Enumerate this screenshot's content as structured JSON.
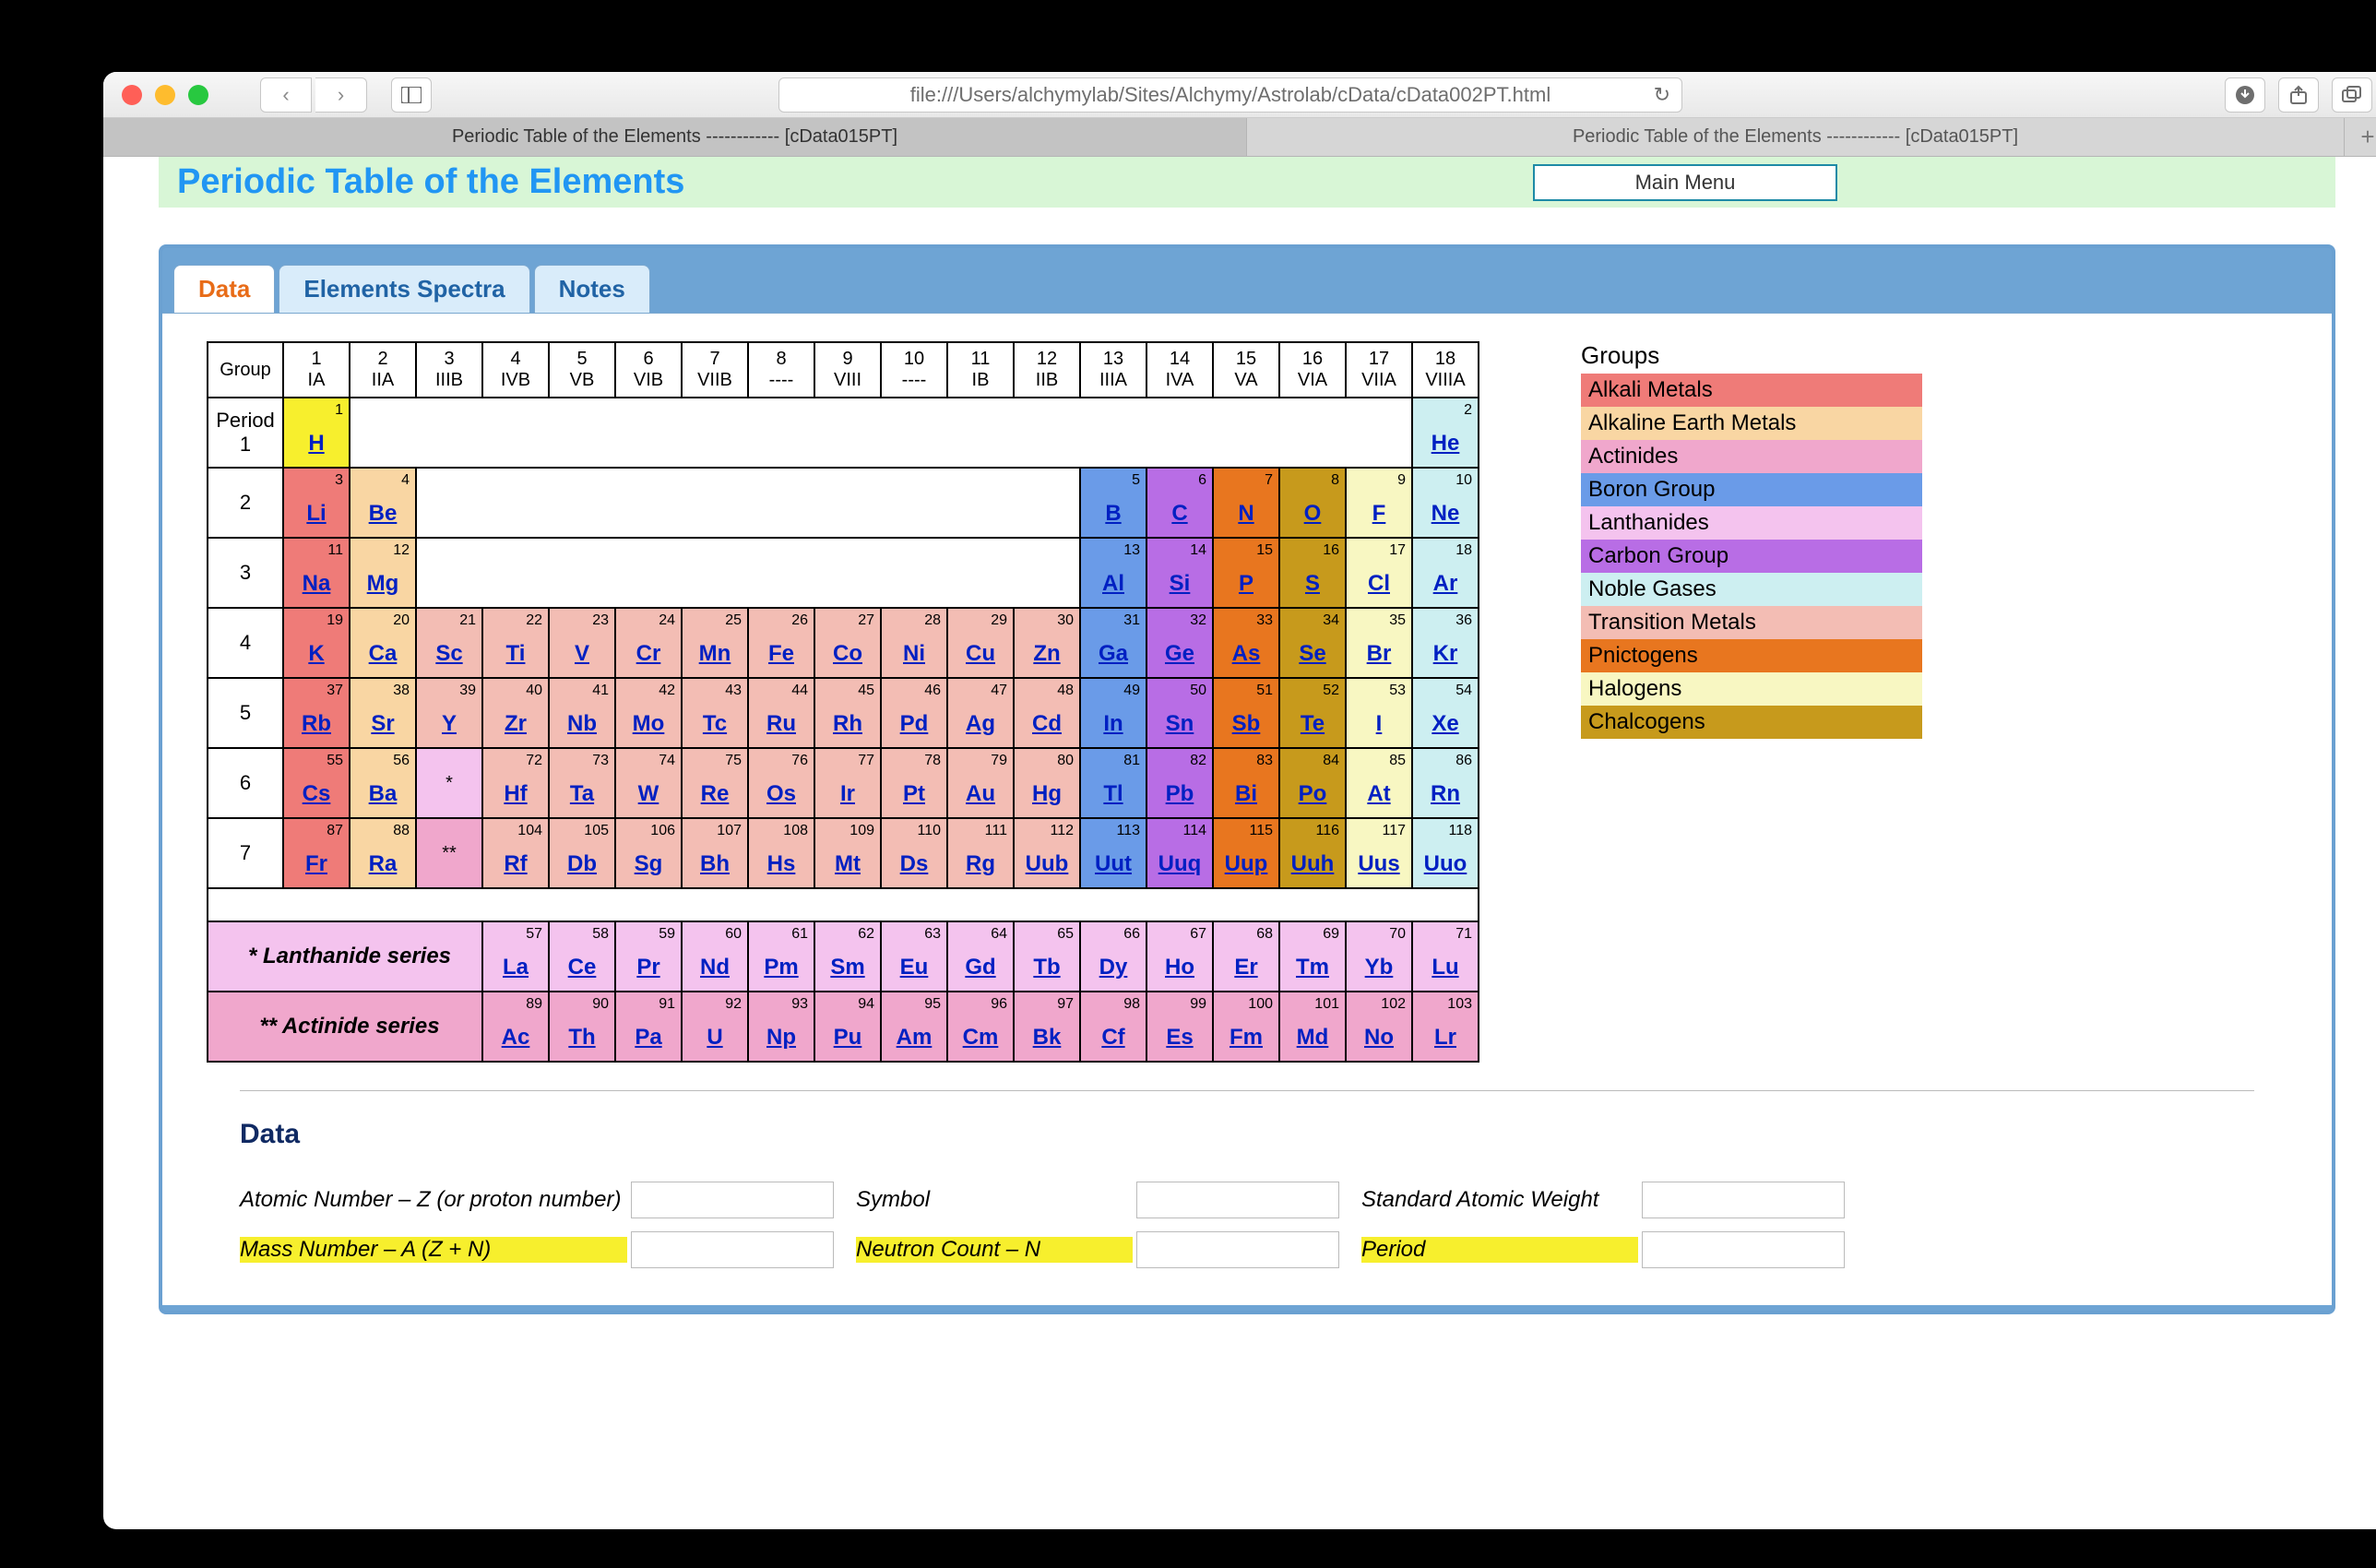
{
  "browser": {
    "url": "file:///Users/alchymylab/Sites/Alchymy/Astrolab/cData/cData002PT.html",
    "tabs": [
      "Periodic Table of the Elements ------------ [cData015PT]",
      "Periodic Table of the Elements ------------ [cData015PT]"
    ],
    "active_tab": 0
  },
  "page": {
    "title": "Periodic Table of the Elements",
    "main_menu_label": "Main Menu",
    "tabs": {
      "data": "Data",
      "spectra": "Elements Spectra",
      "notes": "Notes"
    }
  },
  "group_header": {
    "label": "Group",
    "cols": [
      {
        "n": "1",
        "s": "IA"
      },
      {
        "n": "2",
        "s": "IIA"
      },
      {
        "n": "3",
        "s": "IIIB"
      },
      {
        "n": "4",
        "s": "IVB"
      },
      {
        "n": "5",
        "s": "VB"
      },
      {
        "n": "6",
        "s": "VIB"
      },
      {
        "n": "7",
        "s": "VIIB"
      },
      {
        "n": "8",
        "s": "----"
      },
      {
        "n": "9",
        "s": "VIII"
      },
      {
        "n": "10",
        "s": "----"
      },
      {
        "n": "11",
        "s": "IB"
      },
      {
        "n": "12",
        "s": "IIB"
      },
      {
        "n": "13",
        "s": "IIIA"
      },
      {
        "n": "14",
        "s": "IVA"
      },
      {
        "n": "15",
        "s": "VA"
      },
      {
        "n": "16",
        "s": "VIA"
      },
      {
        "n": "17",
        "s": "VIIA"
      },
      {
        "n": "18",
        "s": "VIIIA"
      }
    ]
  },
  "period_label": "Period",
  "periods": {
    "1": [
      {
        "g": 1,
        "n": 1,
        "s": "H",
        "c": "c-hyd"
      },
      {
        "g": 18,
        "n": 2,
        "s": "He",
        "c": "c-noble"
      }
    ],
    "2": [
      {
        "g": 1,
        "n": 3,
        "s": "Li",
        "c": "c-alk"
      },
      {
        "g": 2,
        "n": 4,
        "s": "Be",
        "c": "c-alke"
      },
      {
        "g": 13,
        "n": 5,
        "s": "B",
        "c": "c-boron"
      },
      {
        "g": 14,
        "n": 6,
        "s": "C",
        "c": "c-carb"
      },
      {
        "g": 15,
        "n": 7,
        "s": "N",
        "c": "c-pnic"
      },
      {
        "g": 16,
        "n": 8,
        "s": "O",
        "c": "c-chal"
      },
      {
        "g": 17,
        "n": 9,
        "s": "F",
        "c": "c-halo"
      },
      {
        "g": 18,
        "n": 10,
        "s": "Ne",
        "c": "c-noble"
      }
    ],
    "3": [
      {
        "g": 1,
        "n": 11,
        "s": "Na",
        "c": "c-alk"
      },
      {
        "g": 2,
        "n": 12,
        "s": "Mg",
        "c": "c-alke"
      },
      {
        "g": 13,
        "n": 13,
        "s": "Al",
        "c": "c-boron"
      },
      {
        "g": 14,
        "n": 14,
        "s": "Si",
        "c": "c-carb"
      },
      {
        "g": 15,
        "n": 15,
        "s": "P",
        "c": "c-pnic"
      },
      {
        "g": 16,
        "n": 16,
        "s": "S",
        "c": "c-chal"
      },
      {
        "g": 17,
        "n": 17,
        "s": "Cl",
        "c": "c-halo"
      },
      {
        "g": 18,
        "n": 18,
        "s": "Ar",
        "c": "c-noble"
      }
    ],
    "4": [
      {
        "g": 1,
        "n": 19,
        "s": "K",
        "c": "c-alk"
      },
      {
        "g": 2,
        "n": 20,
        "s": "Ca",
        "c": "c-alke"
      },
      {
        "g": 3,
        "n": 21,
        "s": "Sc",
        "c": "c-trans"
      },
      {
        "g": 4,
        "n": 22,
        "s": "Ti",
        "c": "c-trans"
      },
      {
        "g": 5,
        "n": 23,
        "s": "V",
        "c": "c-trans"
      },
      {
        "g": 6,
        "n": 24,
        "s": "Cr",
        "c": "c-trans"
      },
      {
        "g": 7,
        "n": 25,
        "s": "Mn",
        "c": "c-trans"
      },
      {
        "g": 8,
        "n": 26,
        "s": "Fe",
        "c": "c-trans"
      },
      {
        "g": 9,
        "n": 27,
        "s": "Co",
        "c": "c-trans"
      },
      {
        "g": 10,
        "n": 28,
        "s": "Ni",
        "c": "c-trans"
      },
      {
        "g": 11,
        "n": 29,
        "s": "Cu",
        "c": "c-trans"
      },
      {
        "g": 12,
        "n": 30,
        "s": "Zn",
        "c": "c-trans"
      },
      {
        "g": 13,
        "n": 31,
        "s": "Ga",
        "c": "c-boron"
      },
      {
        "g": 14,
        "n": 32,
        "s": "Ge",
        "c": "c-carb"
      },
      {
        "g": 15,
        "n": 33,
        "s": "As",
        "c": "c-pnic"
      },
      {
        "g": 16,
        "n": 34,
        "s": "Se",
        "c": "c-chal"
      },
      {
        "g": 17,
        "n": 35,
        "s": "Br",
        "c": "c-halo"
      },
      {
        "g": 18,
        "n": 36,
        "s": "Kr",
        "c": "c-noble"
      }
    ],
    "5": [
      {
        "g": 1,
        "n": 37,
        "s": "Rb",
        "c": "c-alk"
      },
      {
        "g": 2,
        "n": 38,
        "s": "Sr",
        "c": "c-alke"
      },
      {
        "g": 3,
        "n": 39,
        "s": "Y",
        "c": "c-trans"
      },
      {
        "g": 4,
        "n": 40,
        "s": "Zr",
        "c": "c-trans"
      },
      {
        "g": 5,
        "n": 41,
        "s": "Nb",
        "c": "c-trans"
      },
      {
        "g": 6,
        "n": 42,
        "s": "Mo",
        "c": "c-trans"
      },
      {
        "g": 7,
        "n": 43,
        "s": "Tc",
        "c": "c-trans"
      },
      {
        "g": 8,
        "n": 44,
        "s": "Ru",
        "c": "c-trans"
      },
      {
        "g": 9,
        "n": 45,
        "s": "Rh",
        "c": "c-trans"
      },
      {
        "g": 10,
        "n": 46,
        "s": "Pd",
        "c": "c-trans"
      },
      {
        "g": 11,
        "n": 47,
        "s": "Ag",
        "c": "c-trans"
      },
      {
        "g": 12,
        "n": 48,
        "s": "Cd",
        "c": "c-trans"
      },
      {
        "g": 13,
        "n": 49,
        "s": "In",
        "c": "c-boron"
      },
      {
        "g": 14,
        "n": 50,
        "s": "Sn",
        "c": "c-carb"
      },
      {
        "g": 15,
        "n": 51,
        "s": "Sb",
        "c": "c-pnic"
      },
      {
        "g": 16,
        "n": 52,
        "s": "Te",
        "c": "c-chal"
      },
      {
        "g": 17,
        "n": 53,
        "s": "I",
        "c": "c-halo"
      },
      {
        "g": 18,
        "n": 54,
        "s": "Xe",
        "c": "c-noble"
      }
    ],
    "6": [
      {
        "g": 1,
        "n": 55,
        "s": "Cs",
        "c": "c-alk"
      },
      {
        "g": 2,
        "n": 56,
        "s": "Ba",
        "c": "c-alke"
      },
      {
        "g": 3,
        "star": "*",
        "c": "c-lan"
      },
      {
        "g": 4,
        "n": 72,
        "s": "Hf",
        "c": "c-trans"
      },
      {
        "g": 5,
        "n": 73,
        "s": "Ta",
        "c": "c-trans"
      },
      {
        "g": 6,
        "n": 74,
        "s": "W",
        "c": "c-trans"
      },
      {
        "g": 7,
        "n": 75,
        "s": "Re",
        "c": "c-trans"
      },
      {
        "g": 8,
        "n": 76,
        "s": "Os",
        "c": "c-trans"
      },
      {
        "g": 9,
        "n": 77,
        "s": "Ir",
        "c": "c-trans"
      },
      {
        "g": 10,
        "n": 78,
        "s": "Pt",
        "c": "c-trans"
      },
      {
        "g": 11,
        "n": 79,
        "s": "Au",
        "c": "c-trans"
      },
      {
        "g": 12,
        "n": 80,
        "s": "Hg",
        "c": "c-trans"
      },
      {
        "g": 13,
        "n": 81,
        "s": "Tl",
        "c": "c-boron"
      },
      {
        "g": 14,
        "n": 82,
        "s": "Pb",
        "c": "c-carb"
      },
      {
        "g": 15,
        "n": 83,
        "s": "Bi",
        "c": "c-pnic"
      },
      {
        "g": 16,
        "n": 84,
        "s": "Po",
        "c": "c-chal"
      },
      {
        "g": 17,
        "n": 85,
        "s": "At",
        "c": "c-halo"
      },
      {
        "g": 18,
        "n": 86,
        "s": "Rn",
        "c": "c-noble"
      }
    ],
    "7": [
      {
        "g": 1,
        "n": 87,
        "s": "Fr",
        "c": "c-alk"
      },
      {
        "g": 2,
        "n": 88,
        "s": "Ra",
        "c": "c-alke"
      },
      {
        "g": 3,
        "star": "**",
        "c": "c-act"
      },
      {
        "g": 4,
        "n": 104,
        "s": "Rf",
        "c": "c-trans"
      },
      {
        "g": 5,
        "n": 105,
        "s": "Db",
        "c": "c-trans"
      },
      {
        "g": 6,
        "n": 106,
        "s": "Sg",
        "c": "c-trans"
      },
      {
        "g": 7,
        "n": 107,
        "s": "Bh",
        "c": "c-trans"
      },
      {
        "g": 8,
        "n": 108,
        "s": "Hs",
        "c": "c-trans"
      },
      {
        "g": 9,
        "n": 109,
        "s": "Mt",
        "c": "c-trans"
      },
      {
        "g": 10,
        "n": 110,
        "s": "Ds",
        "c": "c-trans"
      },
      {
        "g": 11,
        "n": 111,
        "s": "Rg",
        "c": "c-trans"
      },
      {
        "g": 12,
        "n": 112,
        "s": "Uub",
        "c": "c-trans"
      },
      {
        "g": 13,
        "n": 113,
        "s": "Uut",
        "c": "c-boron"
      },
      {
        "g": 14,
        "n": 114,
        "s": "Uuq",
        "c": "c-carb"
      },
      {
        "g": 15,
        "n": 115,
        "s": "Uup",
        "c": "c-pnic"
      },
      {
        "g": 16,
        "n": 116,
        "s": "Uuh",
        "c": "c-chal"
      },
      {
        "g": 17,
        "n": 117,
        "s": "Uus",
        "c": "c-halo"
      },
      {
        "g": 18,
        "n": 118,
        "s": "Uuo",
        "c": "c-noble"
      }
    ]
  },
  "lanthanide": {
    "label": "* Lanthanide series",
    "items": [
      {
        "n": 57,
        "s": "La"
      },
      {
        "n": 58,
        "s": "Ce"
      },
      {
        "n": 59,
        "s": "Pr"
      },
      {
        "n": 60,
        "s": "Nd"
      },
      {
        "n": 61,
        "s": "Pm"
      },
      {
        "n": 62,
        "s": "Sm"
      },
      {
        "n": 63,
        "s": "Eu"
      },
      {
        "n": 64,
        "s": "Gd"
      },
      {
        "n": 65,
        "s": "Tb"
      },
      {
        "n": 66,
        "s": "Dy"
      },
      {
        "n": 67,
        "s": "Ho"
      },
      {
        "n": 68,
        "s": "Er"
      },
      {
        "n": 69,
        "s": "Tm"
      },
      {
        "n": 70,
        "s": "Yb"
      },
      {
        "n": 71,
        "s": "Lu"
      }
    ]
  },
  "actinide": {
    "label": "** Actinide series",
    "items": [
      {
        "n": 89,
        "s": "Ac"
      },
      {
        "n": 90,
        "s": "Th"
      },
      {
        "n": 91,
        "s": "Pa"
      },
      {
        "n": 92,
        "s": "U"
      },
      {
        "n": 93,
        "s": "Np"
      },
      {
        "n": 94,
        "s": "Pu"
      },
      {
        "n": 95,
        "s": "Am"
      },
      {
        "n": 96,
        "s": "Cm"
      },
      {
        "n": 97,
        "s": "Bk"
      },
      {
        "n": 98,
        "s": "Cf"
      },
      {
        "n": 99,
        "s": "Es"
      },
      {
        "n": 100,
        "s": "Fm"
      },
      {
        "n": 101,
        "s": "Md"
      },
      {
        "n": 102,
        "s": "No"
      },
      {
        "n": 103,
        "s": "Lr"
      }
    ]
  },
  "legend": {
    "title": "Groups",
    "items": [
      {
        "label": "Alkali Metals",
        "c": "c-alk"
      },
      {
        "label": "Alkaline Earth Metals",
        "c": "c-alke"
      },
      {
        "label": "Actinides",
        "c": "c-act"
      },
      {
        "label": "Boron Group",
        "c": "c-boron"
      },
      {
        "label": "Lanthanides",
        "c": "c-lan"
      },
      {
        "label": "Carbon Group",
        "c": "c-carb"
      },
      {
        "label": "Noble Gases",
        "c": "c-noble"
      },
      {
        "label": "Transition Metals",
        "c": "c-trans"
      },
      {
        "label": "Pnictogens",
        "c": "c-pnic"
      },
      {
        "label": "Halogens",
        "c": "c-halo"
      },
      {
        "label": "Chalcogens",
        "c": "c-chal"
      }
    ]
  },
  "data_section": {
    "heading": "Data",
    "rows": [
      [
        {
          "label": "Atomic Number – Z (or proton number)",
          "hl": false
        },
        {
          "label": "Symbol",
          "hl": false
        },
        {
          "label": "Standard Atomic Weight",
          "hl": false
        }
      ],
      [
        {
          "label": "Mass Number – A (Z + N)",
          "hl": true
        },
        {
          "label": "Neutron Count – N",
          "hl": true
        },
        {
          "label": "Period",
          "hl": true
        }
      ]
    ]
  }
}
